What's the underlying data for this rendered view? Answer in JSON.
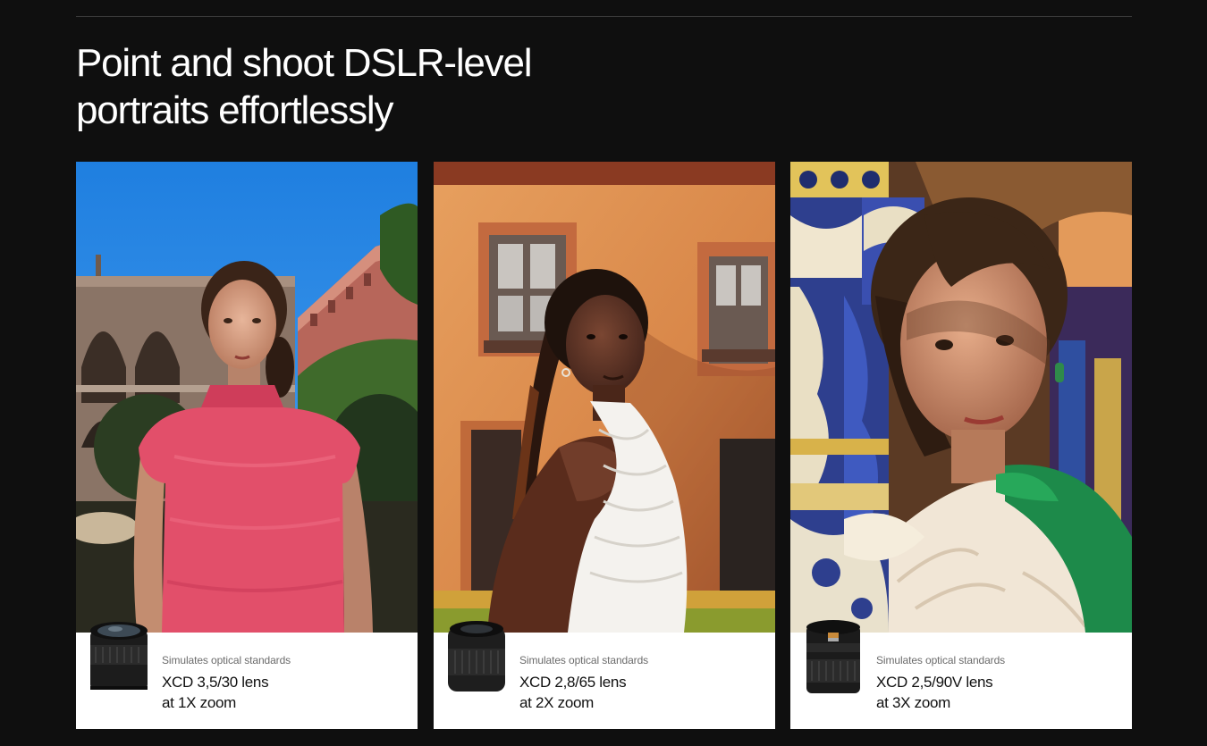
{
  "section": {
    "headline_line1": "Point and shoot DSLR-level",
    "headline_line2": "portraits effortlessly"
  },
  "cards": [
    {
      "subtitle": "Simulates optical standards",
      "lens_name": "XCD 3,5/30 lens",
      "zoom": "at 1X zoom"
    },
    {
      "subtitle": "Simulates optical standards",
      "lens_name": "XCD 2,8/65 lens",
      "zoom": "at 2X zoom"
    },
    {
      "subtitle": "Simulates optical standards",
      "lens_name": "XCD 2,5/90V lens",
      "zoom": "at 3X zoom"
    }
  ],
  "colors": {
    "background": "#0f0f0f",
    "card": "#ffffff",
    "subtitle": "#6b6b6b",
    "text": "#111111"
  }
}
